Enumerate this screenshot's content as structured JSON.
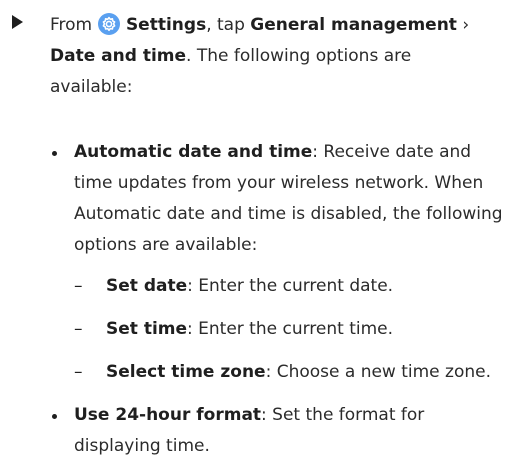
{
  "step": {
    "prefix": "From",
    "settings_label": "Settings",
    "mid": ", tap",
    "general_management": "General management",
    "chevron": "›",
    "date_and_time": "Date and time",
    "suffix": ". The following options are available:"
  },
  "bullets": [
    {
      "title": "Automatic date and time",
      "text": ": Receive date and time updates from your wireless network. When Automatic date and time is disabled, the following options are available:",
      "sub_items": [
        {
          "title": "Set date",
          "text": ": Enter the current date."
        },
        {
          "title": "Set time",
          "text": ": Enter the current time."
        },
        {
          "title": "Select time zone",
          "text": ": Choose a new time zone."
        }
      ]
    },
    {
      "title": "Use 24-hour format",
      "text": ": Set the format for displaying time."
    }
  ],
  "colors": {
    "settings_icon_bg": "#5aa0f0",
    "text": "#2b2b2b"
  },
  "icons": {
    "step_marker": "triangle-right-icon",
    "settings": "gear-icon"
  }
}
